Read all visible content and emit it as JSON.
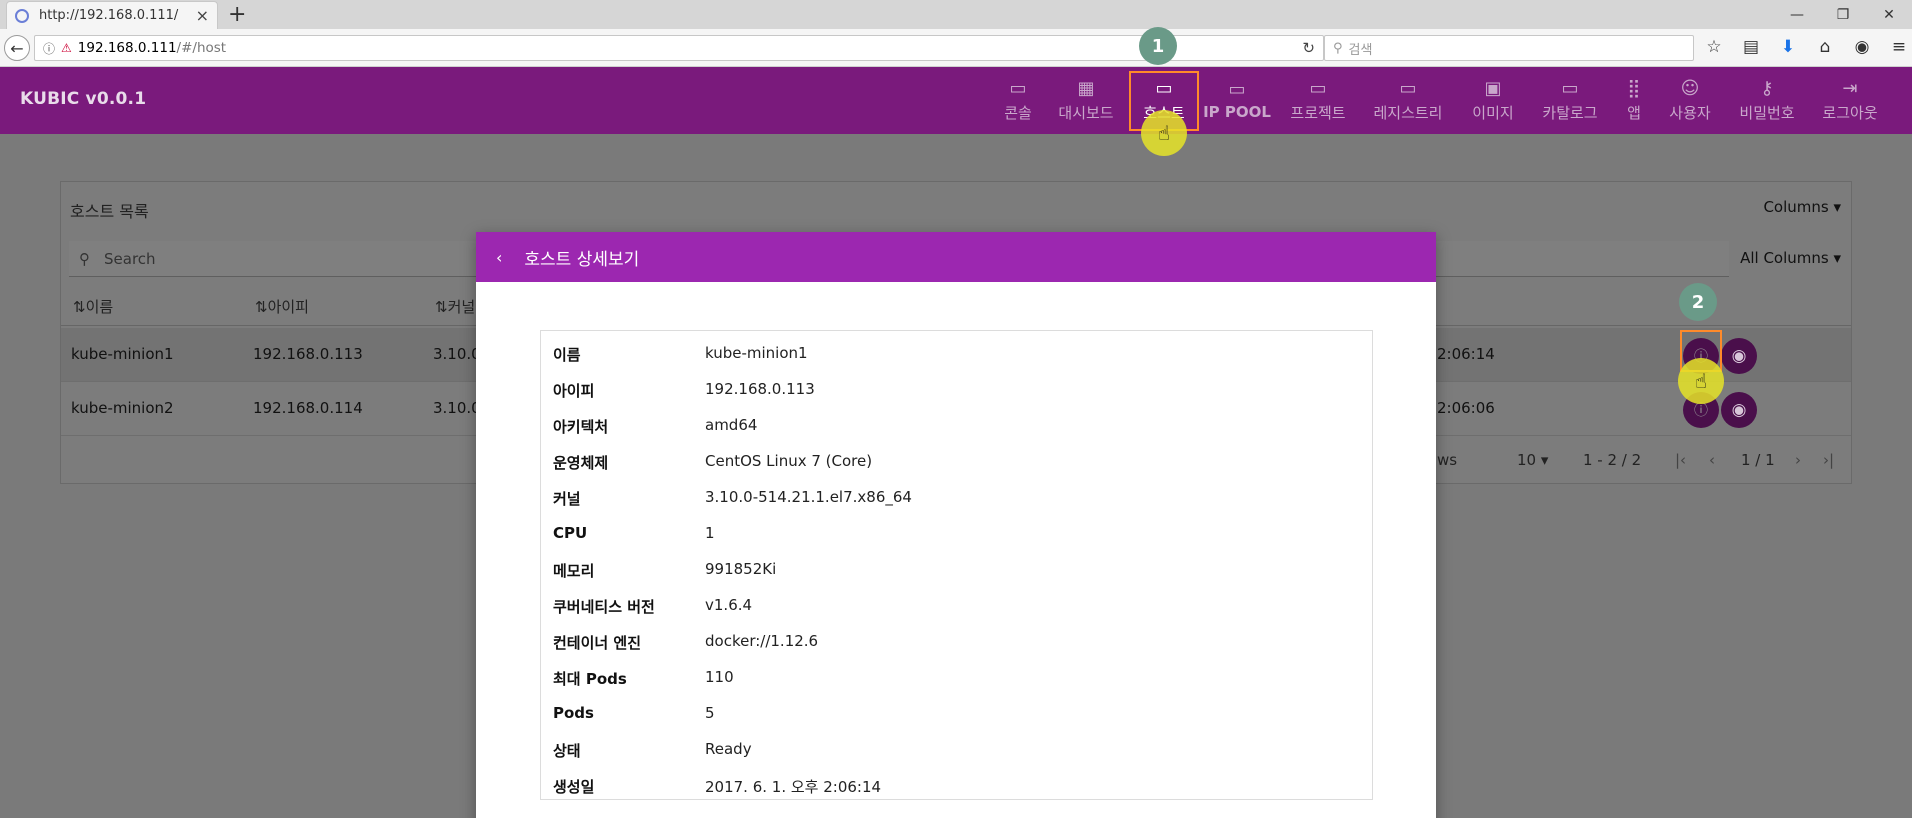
{
  "browser": {
    "tab_title": "http://192.168.0.111/",
    "tab_close": "×",
    "new_tab": "+",
    "back": "←",
    "info_icon": "ⓘ",
    "url_host": "192.168.0.111",
    "url_path": "/#/host",
    "reload": "↻",
    "search_placeholder": "검색",
    "search_icon": "⚲",
    "toolbar_icons": [
      "☆",
      "▤",
      "⬇",
      "⌂",
      "◉",
      "≡"
    ],
    "window_controls": [
      "—",
      "❐",
      "✕"
    ]
  },
  "app": {
    "brand": "KUBIC v0.0.1",
    "menu": [
      {
        "label": "콘솔",
        "icon": "💻"
      },
      {
        "label": "대시보드",
        "icon": "▦"
      },
      {
        "label": "호스트",
        "icon": "💻",
        "active": true
      },
      {
        "label": "IP POOL",
        "icon": "💻"
      },
      {
        "label": "프로젝트",
        "icon": "💻"
      },
      {
        "label": "레지스트리",
        "icon": "💻"
      },
      {
        "label": "이미지",
        "icon": "▣"
      },
      {
        "label": "카탈로그",
        "icon": "💻"
      },
      {
        "label": "앱",
        "icon": "⁞⁞⁞"
      },
      {
        "label": "사용자",
        "icon": "☺"
      },
      {
        "label": "비밀번호",
        "icon": "⚷"
      },
      {
        "label": "로그아웃",
        "icon": "⇥"
      }
    ]
  },
  "host_list": {
    "title": "호스트 목록",
    "columns_button": "Columns ▾",
    "all_columns": "All Columns ▾",
    "search_placeholder": "Search",
    "search_icon": "⚲",
    "headers": [
      "⇅이름",
      "⇅아이피",
      "⇅커널"
    ],
    "rows": [
      {
        "name": "kube-minion1",
        "ip": "192.168.0.113",
        "kernel": "3.10.0",
        "time": "2:06:14"
      },
      {
        "name": "kube-minion2",
        "ip": "192.168.0.114",
        "kernel": "3.10.0",
        "time": "2:06:06"
      }
    ],
    "row_button_info": "ⓘ",
    "row_button_eye": "◉",
    "pager": {
      "rows_label": "ws",
      "page_size": "10 ▾",
      "range": "1 - 2 / 2",
      "first": "|‹",
      "prev": "‹",
      "page": "1 / 1",
      "next": "›",
      "last": "›|"
    }
  },
  "modal": {
    "back_icon": "‹",
    "title": "호스트 상세보기",
    "details": [
      {
        "key": "이름",
        "value": "kube-minion1"
      },
      {
        "key": "아이피",
        "value": "192.168.0.113"
      },
      {
        "key": "아키텍처",
        "value": "amd64"
      },
      {
        "key": "운영체제",
        "value": "CentOS Linux 7 (Core)"
      },
      {
        "key": "커널",
        "value": "3.10.0-514.21.1.el7.x86_64"
      },
      {
        "key": "CPU",
        "value": "1"
      },
      {
        "key": "메모리",
        "value": "991852Ki"
      },
      {
        "key": "쿠버네티스 버전",
        "value": "v1.6.4"
      },
      {
        "key": "컨테이너 엔진",
        "value": "docker://1.12.6"
      },
      {
        "key": "최대 Pods",
        "value": "110"
      },
      {
        "key": "Pods",
        "value": "5"
      },
      {
        "key": "상태",
        "value": "Ready"
      },
      {
        "key": "생성일",
        "value": "2017. 6. 1. 오후 2:06:14"
      }
    ]
  },
  "annotations": {
    "step1": "1",
    "step2": "2",
    "cursor_glyph": "☝"
  },
  "colors": {
    "appbar": "#7a1a7c",
    "modal_header": "#9c27b0",
    "highlight": "#ff8a2a",
    "step_badge": "#6a9a88",
    "cursor": "#e6e428"
  }
}
